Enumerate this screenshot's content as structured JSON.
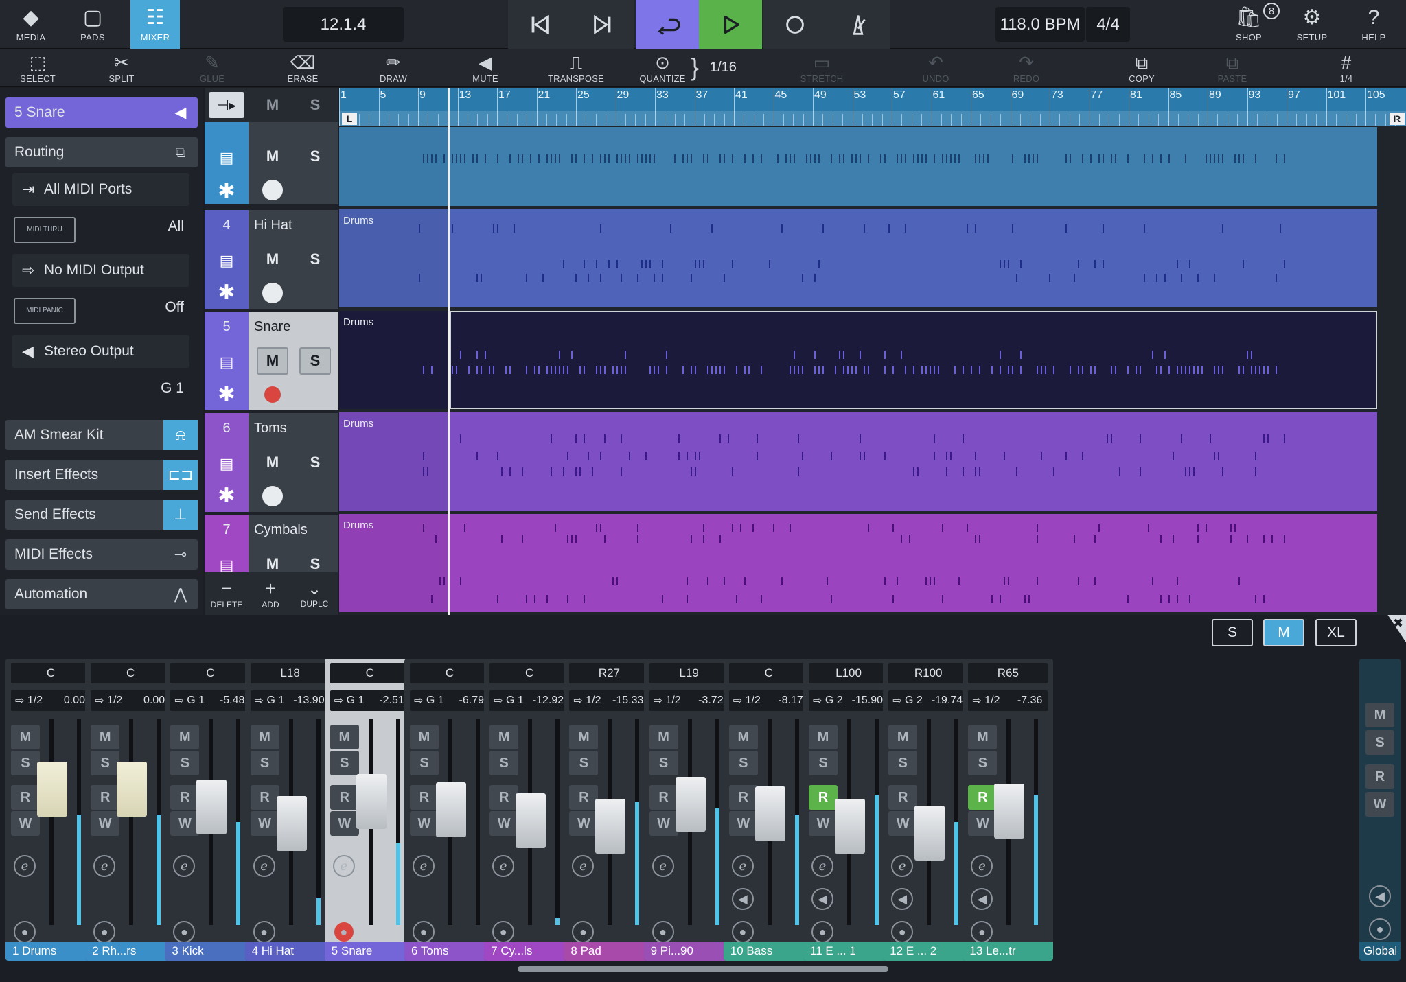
{
  "topbar": {
    "media": "MEDIA",
    "pads": "PADS",
    "mixer": "MIXER",
    "position": "12.1.4",
    "tempo": "118.0 BPM",
    "signature": "4/4",
    "shop": "SHOP",
    "shop_badge": "8",
    "setup": "SETUP",
    "help": "HELP"
  },
  "tools": {
    "select": "SELECT",
    "split": "SPLIT",
    "glue": "GLUE",
    "erase": "ERASE",
    "draw": "DRAW",
    "mute": "MUTE",
    "transpose": "TRANSPOSE",
    "quantize": "QUANTIZE",
    "quantize_value": "1/16",
    "stretch": "STRETCH",
    "undo": "UNDO",
    "redo": "REDO",
    "copy": "COPY",
    "paste": "PASTE",
    "grid_value": "1/4"
  },
  "inspector": {
    "track_title": "5  Snare",
    "routing": "Routing",
    "midi_in": "All MIDI Ports",
    "midi_thru_label": "MIDI THRU",
    "midi_thru_value": "All",
    "midi_out": "No MIDI Output",
    "midi_panic_label": "MIDI PANIC",
    "midi_panic_value": "Off",
    "audio_out": "Stereo Output",
    "group": "G 1",
    "instrument": "AM Smear Kit",
    "insert_effects": "Insert Effects",
    "send_effects": "Send Effects",
    "midi_effects": "MIDI Effects",
    "automation": "Automation"
  },
  "trackhead_toolbar": {
    "m": "M",
    "s": "S",
    "delete": "DELETE",
    "add": "ADD",
    "duplicate": "DUPLC"
  },
  "tracks": [
    {
      "num": "",
      "name": "",
      "clip": ""
    },
    {
      "num": "4",
      "name": "Hi Hat",
      "clip": "Drums"
    },
    {
      "num": "5",
      "name": "Snare",
      "clip": "Drums"
    },
    {
      "num": "6",
      "name": "Toms",
      "clip": "Drums"
    },
    {
      "num": "7",
      "name": "Cymbals",
      "clip": "Drums"
    }
  ],
  "ruler": {
    "bars": [
      "1",
      "5",
      "9",
      "13",
      "17",
      "21",
      "25",
      "29",
      "33",
      "37",
      "41",
      "45",
      "49",
      "53",
      "57",
      "61",
      "65",
      "69",
      "73",
      "77",
      "81",
      "85",
      "89",
      "93",
      "97",
      "101",
      "105"
    ],
    "left_locator": "L",
    "right_locator": "R"
  },
  "mixer_sizes": [
    "S",
    "M",
    "XL"
  ],
  "mixer_strips": [
    {
      "pan": "C",
      "route": "1/2",
      "vol": "0.00",
      "name": "1  Drums",
      "color": "#3a8fc9"
    },
    {
      "pan": "C",
      "route": "1/2",
      "vol": "0.00",
      "name": "2  Rh...rs",
      "color": "#3a8fc9"
    },
    {
      "pan": "C",
      "route": "G 1",
      "vol": "-5.48",
      "name": "3  Kick",
      "color": "#4a6fbf"
    },
    {
      "pan": "L18",
      "route": "G 1",
      "vol": "-13.90",
      "name": "4  Hi Hat",
      "color": "#5a5fc4"
    },
    {
      "pan": "C",
      "route": "G 1",
      "vol": "-2.51",
      "name": "5  Snare",
      "color": "#7466d8"
    },
    {
      "pan": "C",
      "route": "G 1",
      "vol": "-6.79",
      "name": "6  Toms",
      "color": "#8d53c8"
    },
    {
      "pan": "C",
      "route": "G 1",
      "vol": "-12.92",
      "name": "7  Cy...ls",
      "color": "#a048c4"
    },
    {
      "pan": "R27",
      "route": "1/2",
      "vol": "-15.33",
      "name": "8  Pad",
      "color": "#a84aaa"
    },
    {
      "pan": "L19",
      "route": "1/2",
      "vol": "-3.72",
      "name": "9  Pi...90",
      "color": "#9a4fb4"
    },
    {
      "pan": "C",
      "route": "1/2",
      "vol": "-8.17",
      "name": "10  Bass",
      "color": "#3aa58a"
    },
    {
      "pan": "L100",
      "route": "G 2",
      "vol": "-15.90",
      "name": "11  E ... 1",
      "color": "#3aa58a"
    },
    {
      "pan": "R100",
      "route": "G 2",
      "vol": "-19.74",
      "name": "12  E ... 2",
      "color": "#3aa58a"
    },
    {
      "pan": "R65",
      "route": "1/2",
      "vol": "-7.36",
      "name": "13  Le...tr",
      "color": "#3aa58a"
    }
  ],
  "global_strip": {
    "name": "Global"
  },
  "accent": "#4aa8d8"
}
